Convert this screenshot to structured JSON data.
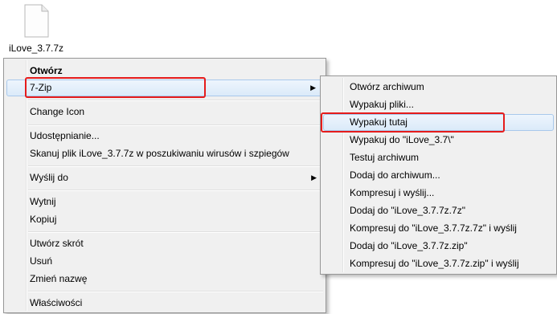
{
  "desktop": {
    "file_name": "iLove_3.7.7z"
  },
  "context_menu": {
    "items": [
      {
        "label": "Otwórz"
      },
      {
        "label": "7-Zip"
      },
      {
        "label": "Change Icon"
      },
      {
        "label": "Udostępnianie..."
      },
      {
        "label": "Skanuj plik iLove_3.7.7z w poszukiwaniu wirusów i szpiegów"
      },
      {
        "label": "Wyślij do"
      },
      {
        "label": "Wytnij"
      },
      {
        "label": "Kopiuj"
      },
      {
        "label": "Utwórz skrót"
      },
      {
        "label": "Usuń"
      },
      {
        "label": "Zmień nazwę"
      },
      {
        "label": "Właściwości"
      }
    ]
  },
  "sevenzip_submenu": {
    "items": [
      {
        "label": "Otwórz archiwum"
      },
      {
        "label": "Wypakuj pliki..."
      },
      {
        "label": "Wypakuj tutaj"
      },
      {
        "label": "Wypakuj do \"iLove_3.7\\\""
      },
      {
        "label": "Testuj archiwum"
      },
      {
        "label": "Dodaj do archiwum..."
      },
      {
        "label": "Kompresuj i wyślij..."
      },
      {
        "label": "Dodaj do \"iLove_3.7.7z.7z\""
      },
      {
        "label": "Kompresuj do \"iLove_3.7.7z.7z\" i wyślij"
      },
      {
        "label": "Dodaj do \"iLove_3.7.7z.zip\""
      },
      {
        "label": "Kompresuj do \"iLove_3.7.7z.zip\" i wyślij"
      }
    ]
  },
  "colors": {
    "highlight_annotation": "#e51c1c",
    "menu_background": "#f0f0f0",
    "hover_background": "#dbeaf9"
  }
}
